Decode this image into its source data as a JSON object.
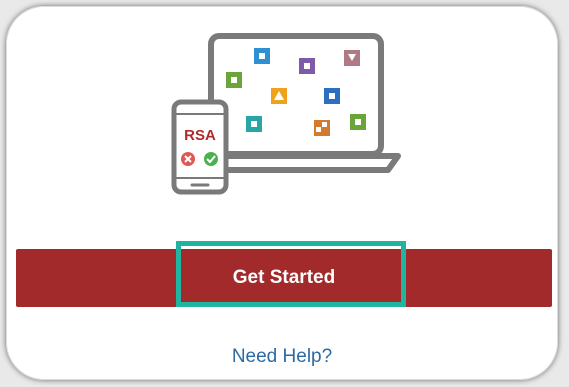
{
  "illustration": {
    "phone_brand_text": "RSA",
    "icons": [
      "laptop-icon",
      "phone-icon",
      "reject-icon",
      "approve-icon",
      "app-tile-icon"
    ],
    "colors": {
      "laptop_frame": "#7a7a7a",
      "rsa_red": "#b22a2a",
      "reject": "#e05757",
      "approve": "#4caf50"
    }
  },
  "primary_action": {
    "label": "Get Started",
    "color": "#a22a2a"
  },
  "highlight": {
    "color": "#1fb5a0"
  },
  "help": {
    "label": "Need Help?",
    "color": "#2c6aa3"
  }
}
